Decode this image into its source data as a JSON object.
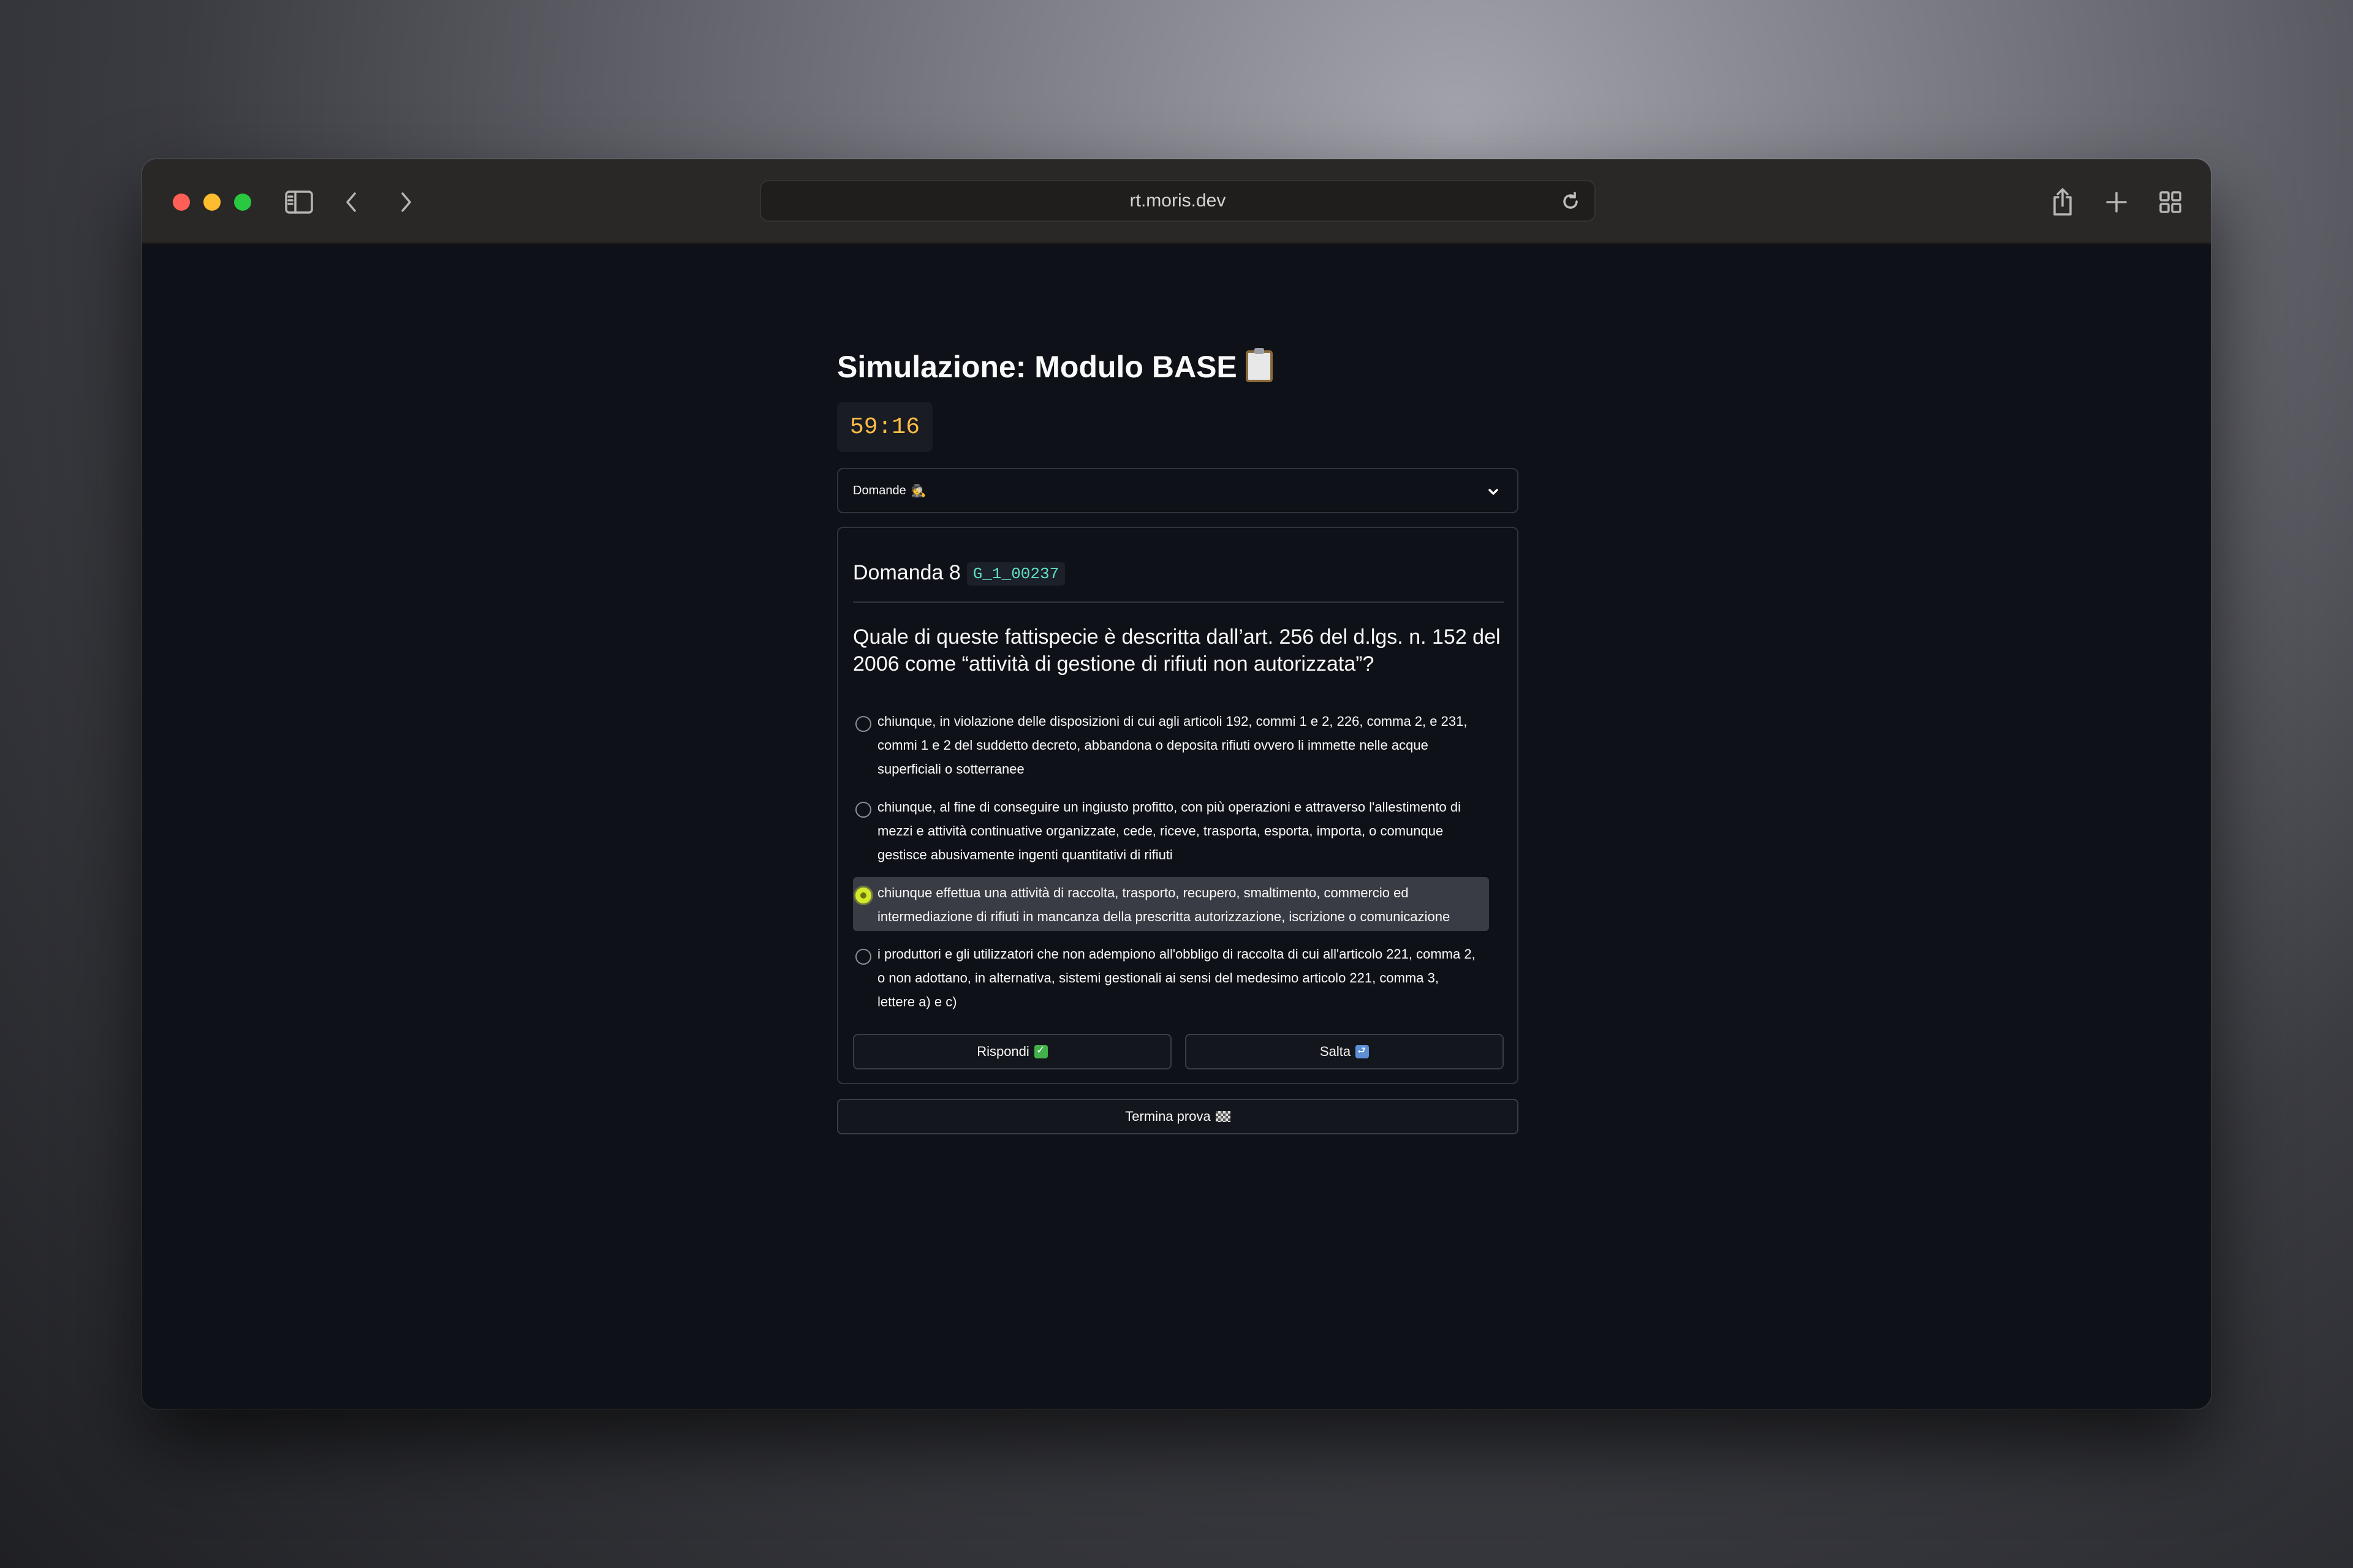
{
  "browser": {
    "url": "rt.moris.dev"
  },
  "page": {
    "title": "Simulazione: Modulo BASE",
    "timer": "59:16",
    "expander_label": "Domande",
    "expander_emoji": "🕵"
  },
  "question": {
    "label": "Domanda 8",
    "code": "G_1_00237",
    "text": "Quale di queste fattispecie è descritta dall’art. 256 del d.lgs. n. 152 del 2006 come “attività di gestione di rifiuti non autorizzata”?",
    "selected_index": 2,
    "options": [
      "chiunque, in violazione delle disposizioni di cui agli articoli 192, commi 1 e 2, 226, comma 2, e 231, commi 1 e 2 del suddetto decreto, abbandona o deposita rifiuti ovvero li immette nelle acque superficiali o sotterranee",
      "chiunque, al fine di conseguire un ingiusto profitto, con più operazioni e attraverso l'allestimento di mezzi e attività continuative organizzate, cede, riceve, trasporta, esporta, importa, o comunque gestisce abusivamente ingenti quantitativi di rifiuti",
      "chiunque effettua una attività di raccolta, trasporto, recupero, smaltimento, commercio ed intermediazione di rifiuti in mancanza della prescritta autorizzazione, iscrizione o comunicazione",
      "i produttori e gli utilizzatori che non adempiono all'obbligo di raccolta di cui all'articolo 221, comma 2, o non adottano, in alternativa, sistemi gestionali ai sensi del medesimo articolo 221, comma 3, lettere a) e c)"
    ]
  },
  "buttons": {
    "answer": "Rispondi",
    "skip": "Salta",
    "finish": "Termina prova"
  },
  "colors": {
    "timer": "#ffbd45",
    "code": "#5ee0c6",
    "radio_selected": "#d4e92a",
    "background": "#0e1117"
  }
}
